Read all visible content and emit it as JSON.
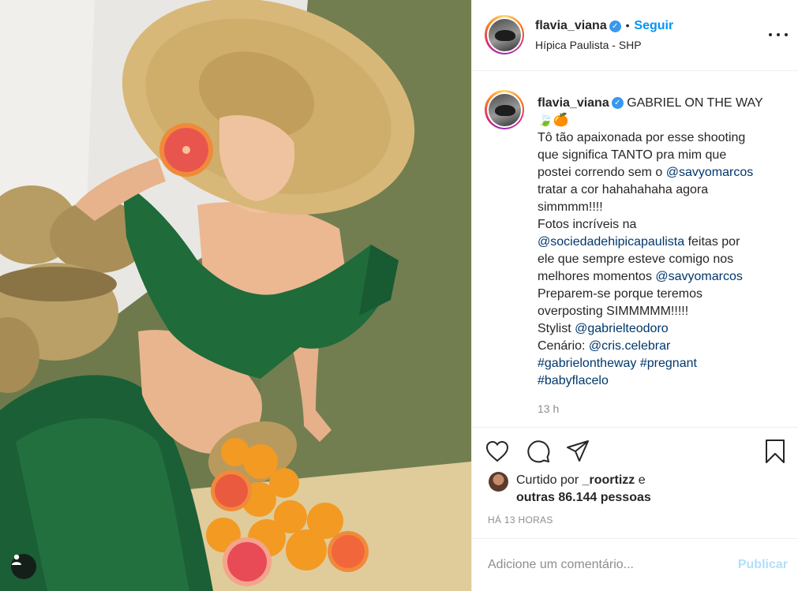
{
  "post": {
    "author": {
      "username": "flavia_viana",
      "verified_mark": "✓",
      "location": "Hípica Paulista - SHP",
      "follow_label": "Seguir",
      "dot": "•"
    },
    "caption": {
      "username": "flavia_viana",
      "lines": [
        {
          "text": "GABRIEL ON THE WAY"
        },
        {
          "text": "🍃🍊"
        },
        {
          "text": "Tô tão apaixonada por esse shooting"
        },
        {
          "text": "que significa TANTO pra mim que"
        },
        {
          "pre": "postei correndo sem o ",
          "link": "@savyomarcos"
        },
        {
          "text": "tratar a cor hahahahaha agora"
        },
        {
          "text": "simmmm!!!!"
        },
        {
          "text": "Fotos incríveis na"
        },
        {
          "link": "@sociedadehipicapaulista",
          "post": " feitas por"
        },
        {
          "text": "ele que sempre esteve comigo nos"
        },
        {
          "pre": "melhores momentos ",
          "link": "@savyomarcos"
        },
        {
          "text": "Preparem-se porque teremos"
        },
        {
          "text": "overposting SIMMMMM!!!!!"
        },
        {
          "pre": "Stylist ",
          "link": "@gabrielteodoro"
        },
        {
          "pre": "Cenário: ",
          "link": "@cris.celebrar"
        },
        {
          "link": "#gabrielontheway",
          "post": " ",
          "link2": "#pregnant"
        },
        {
          "link": "#babyflacelo"
        }
      ],
      "time": "13 h"
    },
    "actions": {
      "like_icon": "heart-icon",
      "comment_icon": "comment-icon",
      "share_icon": "paper-plane-icon",
      "save_icon": "bookmark-icon"
    },
    "likes": {
      "prefix": "Curtido por ",
      "liker": "_roortizz",
      "conj": " e",
      "others": "outras 86.144 pessoas"
    },
    "time_ago": "HÁ 13 HORAS",
    "comment": {
      "placeholder": "Adicione um comentário...",
      "publish_label": "Publicar"
    },
    "colors": {
      "link": "#00376b",
      "follow": "#0095f6",
      "publish_disabled": "#b2dffc",
      "muted": "#8e8e8e"
    }
  }
}
